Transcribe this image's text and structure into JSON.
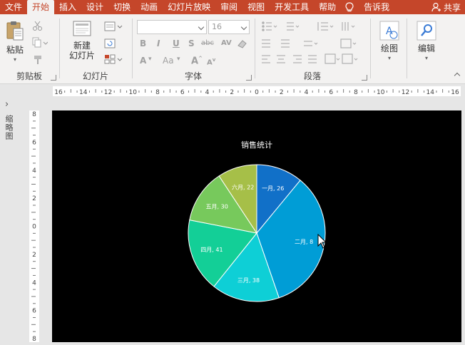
{
  "tabs": [
    "文件",
    "开始",
    "插入",
    "设计",
    "切换",
    "动画",
    "幻灯片放映",
    "审阅",
    "视图",
    "开发工具",
    "帮助"
  ],
  "tell_me": "告诉我",
  "share": "共享",
  "ribbon": {
    "clipboard": {
      "label": "剪贴板",
      "paste": "粘贴"
    },
    "slides": {
      "label": "幻灯片",
      "new_slide_line1": "新建",
      "new_slide_line2": "幻灯片"
    },
    "font": {
      "label": "字体",
      "font_size": "16",
      "bold": "B",
      "italic": "I",
      "underline": "U",
      "shadow": "S",
      "strike": "abc",
      "spacing": "AV",
      "font_color": "A",
      "case": "Aa",
      "clear": "A"
    },
    "paragraph": {
      "label": "段落"
    },
    "drawing": {
      "label": "绘图"
    },
    "editing": {
      "label": "编辑"
    }
  },
  "left_pane": {
    "label": "缩略图"
  },
  "hruler_labels": [
    "16",
    "14",
    "12",
    "10",
    "8",
    "6",
    "4",
    "2",
    "0",
    "2",
    "4",
    "6",
    "8",
    "10",
    "12",
    "14",
    "16"
  ],
  "vruler_labels": [
    "8",
    "6",
    "4",
    "2",
    "0",
    "2",
    "4",
    "6",
    "8"
  ],
  "chart_data": {
    "type": "pie",
    "title": "销售统计",
    "categories": [
      "一月",
      "二月",
      "三月",
      "四月",
      "五月",
      "六月"
    ],
    "values": [
      26,
      80,
      38,
      41,
      30,
      22
    ],
    "data_labels": [
      "一月, 26",
      "二月, 8",
      "三月, 38",
      "四月, 41",
      "五月, 30",
      "六月, 22"
    ],
    "colors": [
      "#1170c8",
      "#009dd6",
      "#0ecfd6",
      "#13cf97",
      "#77c95c",
      "#a6bf48"
    ]
  },
  "colors": {
    "accent": "#c5462a",
    "slide_bg": "#000000"
  }
}
